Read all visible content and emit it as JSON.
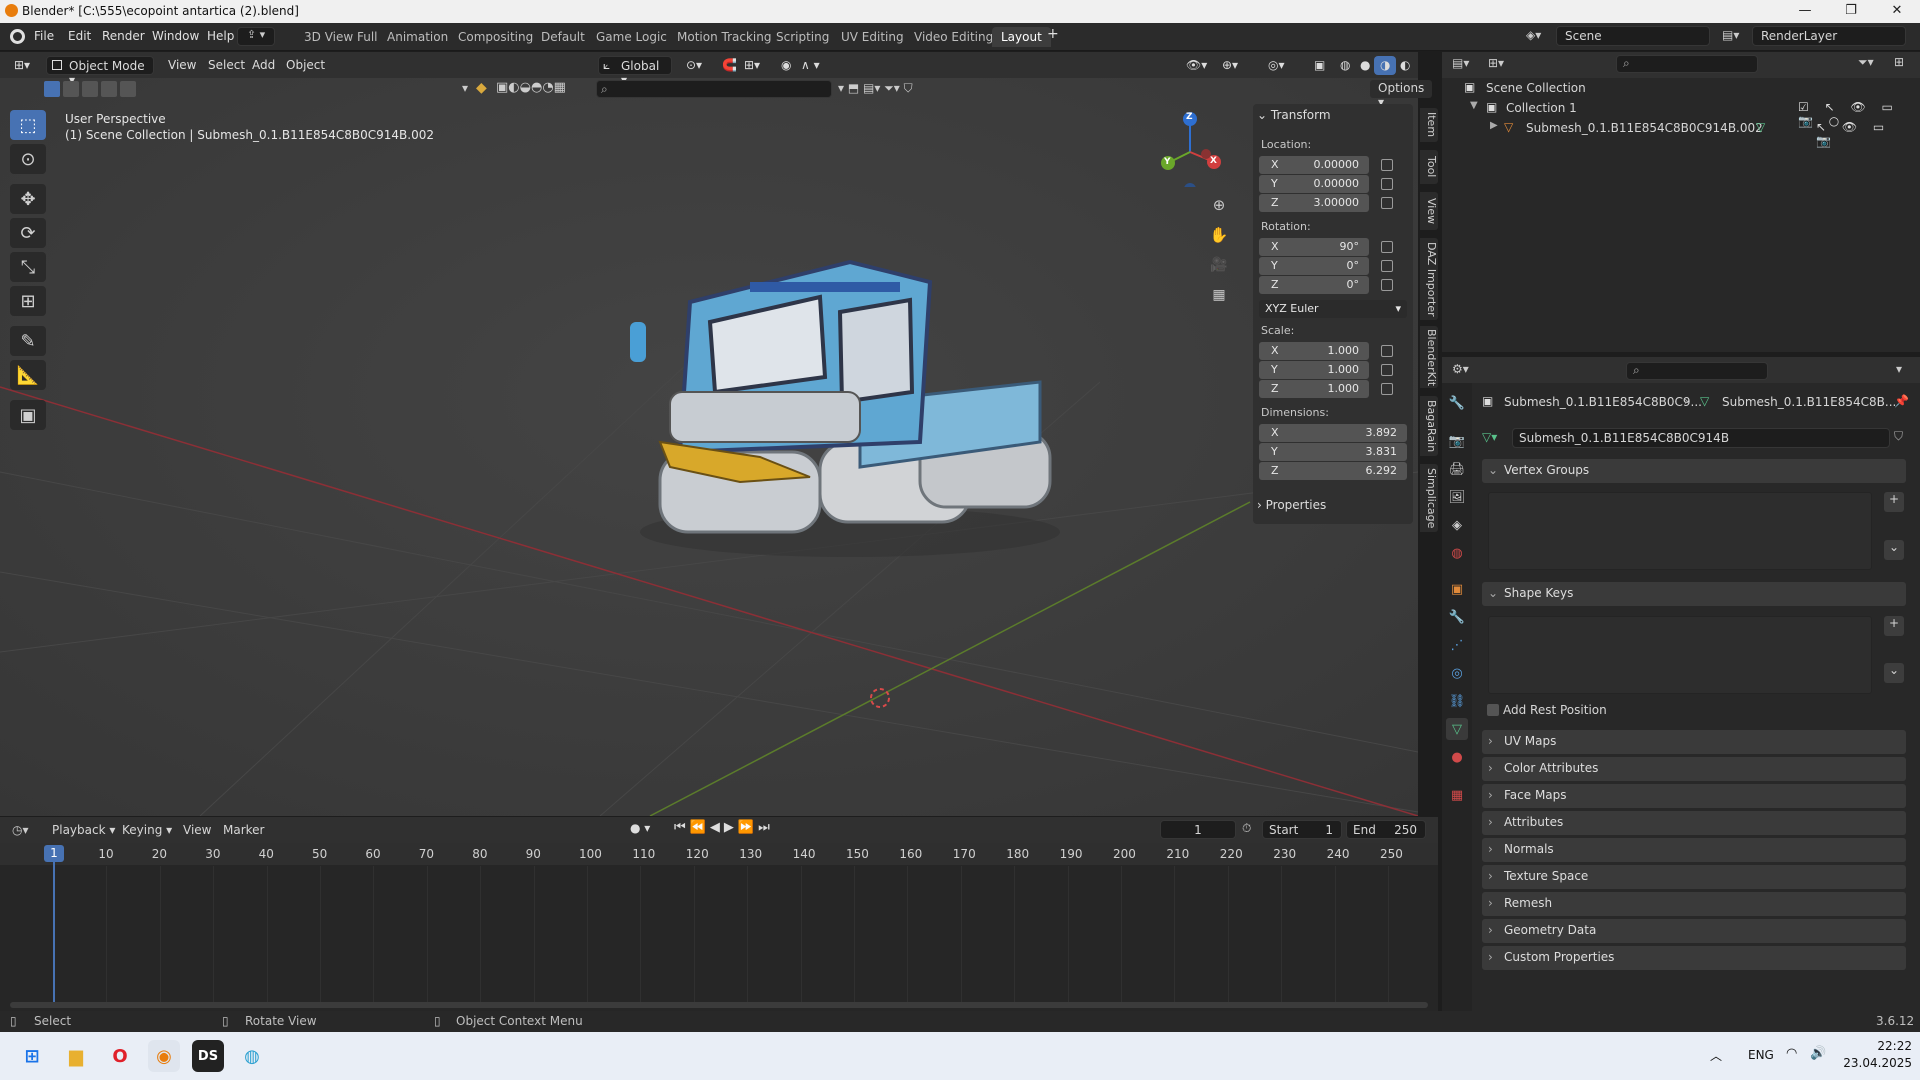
{
  "titlebar": {
    "title": "Blender* [C:\\555\\ecopoint antartica (2).blend]",
    "minimize": "—",
    "maximize": "❐",
    "close": "✕"
  },
  "menubar": {
    "menus": [
      "File",
      "Edit",
      "Render",
      "Window",
      "Help"
    ],
    "workspaces": [
      "3D View Full",
      "Animation",
      "Compositing",
      "Default",
      "Game Logic",
      "Motion Tracking",
      "Scripting",
      "UV Editing",
      "Video Editing",
      "Layout"
    ],
    "active_workspace": "Layout",
    "add_tab": "+",
    "scene": "Scene",
    "view_layer": "RenderLayer"
  },
  "viewport_header": {
    "mode": "Object Mode",
    "menus": [
      "View",
      "Select",
      "Add",
      "Object"
    ],
    "transform_orientation": "Global",
    "options": "Options"
  },
  "viewport": {
    "view_name": "User Perspective",
    "collection_info": "(1) Scene Collection | Submesh_0.1.B11E854C8B0C914B.002",
    "gizmo_axes": {
      "x": "X",
      "y": "Y",
      "z": "Z"
    }
  },
  "npanel": {
    "section_transform": "Transform",
    "location_label": "Location:",
    "location": [
      {
        "axis": "X",
        "value": "0.00000"
      },
      {
        "axis": "Y",
        "value": "0.00000"
      },
      {
        "axis": "Z",
        "value": "3.00000"
      }
    ],
    "rotation_label": "Rotation:",
    "rotation": [
      {
        "axis": "X",
        "value": "90°"
      },
      {
        "axis": "Y",
        "value": "0°"
      },
      {
        "axis": "Z",
        "value": "0°"
      }
    ],
    "rotation_mode": "XYZ Euler",
    "scale_label": "Scale:",
    "scale": [
      {
        "axis": "X",
        "value": "1.000"
      },
      {
        "axis": "Y",
        "value": "1.000"
      },
      {
        "axis": "Z",
        "value": "1.000"
      }
    ],
    "dimensions_label": "Dimensions:",
    "dimensions": [
      {
        "axis": "X",
        "value": "3.892"
      },
      {
        "axis": "Y",
        "value": "3.831"
      },
      {
        "axis": "Z",
        "value": "6.292"
      }
    ],
    "section_properties": "Properties",
    "side_tabs": [
      "Item",
      "Tool",
      "View",
      "DAZ Importer",
      "BlenderKit",
      "BagaRain",
      "Simplicage"
    ]
  },
  "timeline": {
    "menus": [
      "Playback",
      "Keying",
      "View",
      "Marker"
    ],
    "current_frame": "1",
    "start_label": "Start",
    "start": "1",
    "end_label": "End",
    "end": "250",
    "ruler": [
      "10",
      "20",
      "30",
      "40",
      "50",
      "60",
      "70",
      "80",
      "90",
      "100",
      "110",
      "120",
      "130",
      "140",
      "150",
      "160",
      "170",
      "180",
      "190",
      "200",
      "210",
      "220",
      "230",
      "240",
      "250"
    ],
    "playhead": "1"
  },
  "outliner": {
    "root": "Scene Collection",
    "collection": "Collection 1",
    "object": "Submesh_0.1.B11E854C8B0C914B.002"
  },
  "properties": {
    "breadcrumb_object": "Submesh_0.1.B11E854C8B0C9...",
    "breadcrumb_mesh": "Submesh_0.1.B11E854C8B...",
    "mesh_name": "Submesh_0.1.B11E854C8B0C914B",
    "vertex_groups": "Vertex Groups",
    "shape_keys": "Shape Keys",
    "add_rest_position": "Add Rest Position",
    "sections": [
      "UV Maps",
      "Color Attributes",
      "Face Maps",
      "Attributes",
      "Normals",
      "Texture Space",
      "Remesh",
      "Geometry Data",
      "Custom Properties"
    ]
  },
  "statusbar": {
    "select": "Select",
    "rotate": "Rotate View",
    "context": "Object Context Menu",
    "version": "3.6.12"
  },
  "taskbar": {
    "lang": "ENG",
    "time": "22:22",
    "date": "23.04.2025"
  }
}
